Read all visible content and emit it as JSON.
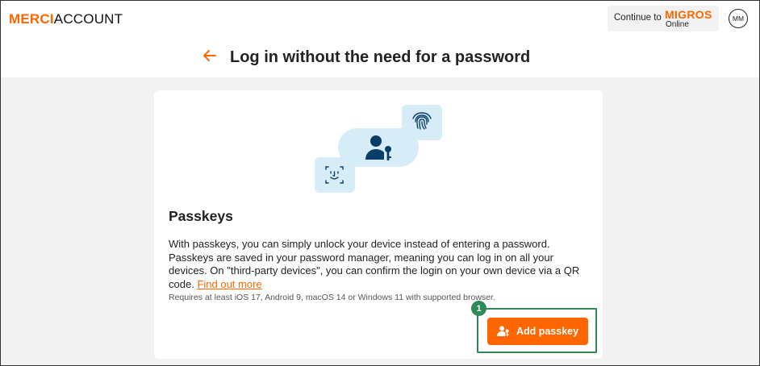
{
  "header": {
    "brand_part1": "MERCI",
    "brand_part2": "ACCOUNT",
    "continue_label": "Continue to",
    "continue_brand": "MIGROS",
    "continue_sub": "Online",
    "avatar_initials": "MM",
    "back_icon": "arrow-left-icon"
  },
  "page": {
    "title": "Log in without the need for a password"
  },
  "card": {
    "heading": "Passkeys",
    "description": "With passkeys, you can simply unlock your device instead of entering a password. Passkeys are saved in your password manager, meaning you can log in on all your devices. On \"third-party devices\", you can confirm the login on your own device via a QR code.",
    "find_out_more": "Find out more",
    "requirements": "Requires at least iOS 17, Android 9, macOS 14 or Windows 11 with supported browser.",
    "step_number": "1",
    "add_button_label": "Add passkey",
    "add_button_icon": "user-key-icon"
  },
  "colors": {
    "accent": "#ff6600",
    "highlight": "#2e8b57",
    "illustration_bg": "#d6ecf7",
    "illustration_fg": "#0b3d6b"
  }
}
